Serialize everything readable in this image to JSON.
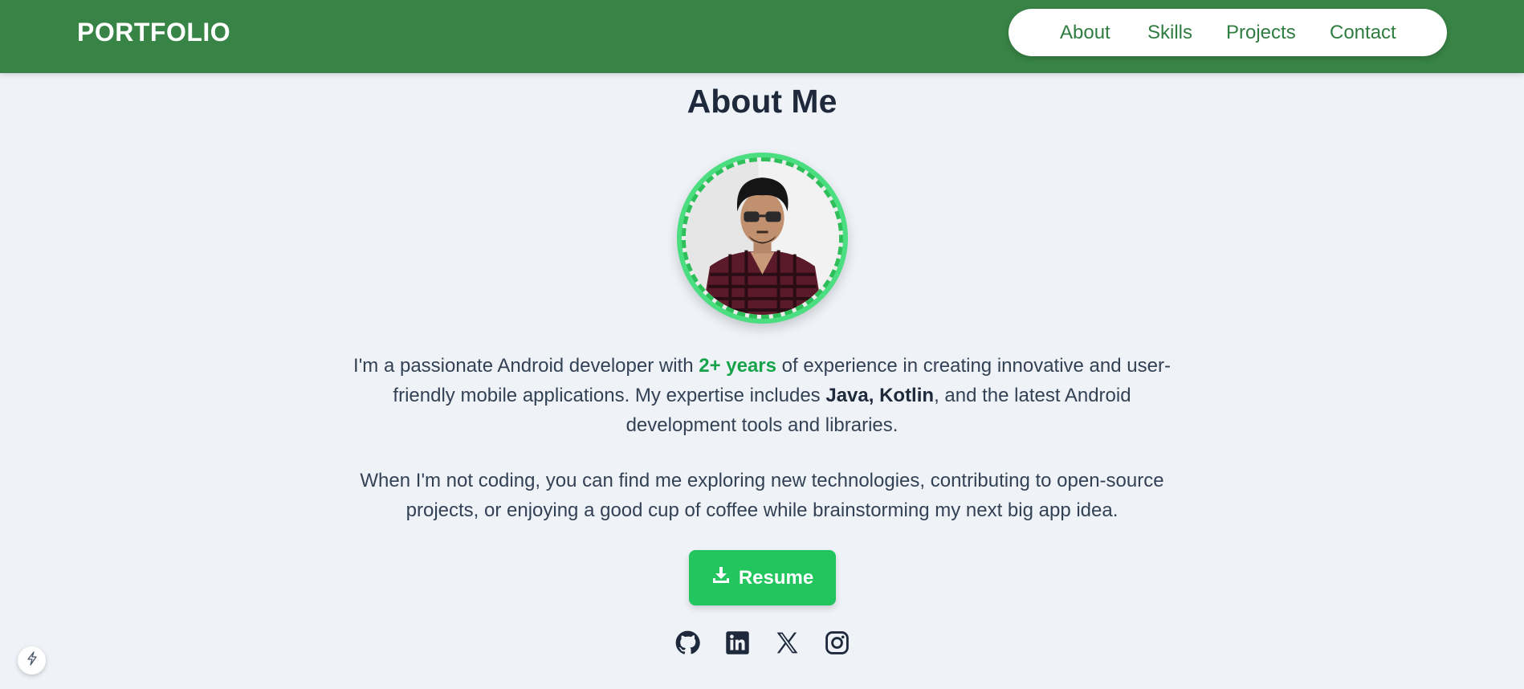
{
  "header": {
    "brand": "PORTFOLIO",
    "nav": {
      "about": "About",
      "skills": "Skills",
      "projects": "Projects",
      "contact": "Contact"
    }
  },
  "about": {
    "title": "About Me",
    "profile_photo": "profile-photo",
    "p1": {
      "before": "I'm a passionate Android developer with ",
      "highlight": "2+ years",
      "middle": " of experience in creating innovative and user-friendly mobile applications. My expertise includes ",
      "bold": "Java, Kotlin",
      "after": ", and the latest Android development tools and libraries."
    },
    "p2": "When I'm not coding, you can find me exploring new technologies, contributing to open-source projects, or enjoying a good cup of coffee while brainstorming my next big app idea.",
    "resume_label": "Resume",
    "socials": [
      "github-icon",
      "linkedin-icon",
      "x-icon",
      "instagram-icon"
    ]
  },
  "colors": {
    "header_bg": "#388446",
    "accent": "#16a34a",
    "button": "#22c55e",
    "ring": "#4ade80",
    "page_bg": "#eff3f8"
  }
}
